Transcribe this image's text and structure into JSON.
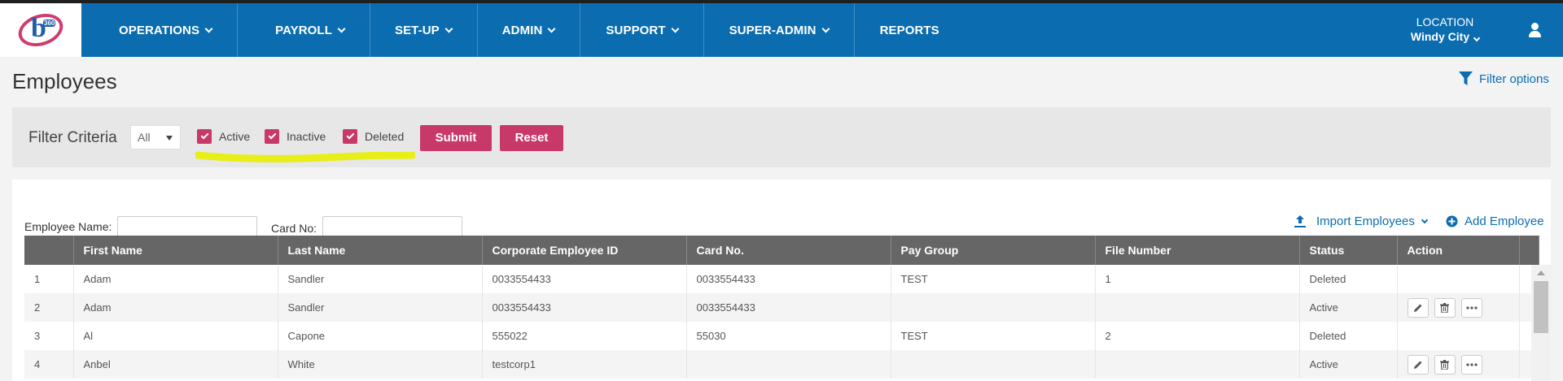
{
  "nav": {
    "logo_badge": "360",
    "menu": [
      {
        "label": "OPERATIONS",
        "has_dropdown": true
      },
      {
        "label": "PAYROLL",
        "has_dropdown": true
      },
      {
        "label": "SET-UP",
        "has_dropdown": true
      },
      {
        "label": "ADMIN",
        "has_dropdown": true
      },
      {
        "label": "SUPPORT",
        "has_dropdown": true
      },
      {
        "label": "SUPER-ADMIN",
        "has_dropdown": true
      },
      {
        "label": "REPORTS",
        "has_dropdown": false
      }
    ],
    "location_label": "LOCATION",
    "location_value": "Windy City",
    "colors": {
      "bar": "#0b6db0",
      "accent": "#c83868"
    }
  },
  "page": {
    "title": "Employees",
    "filter_options_label": "Filter options"
  },
  "filter": {
    "label": "Filter Criteria",
    "select_value": "All",
    "checkboxes": [
      {
        "label": "Active",
        "checked": true
      },
      {
        "label": "Inactive",
        "checked": true
      },
      {
        "label": "Deleted",
        "checked": true
      }
    ],
    "submit_label": "Submit",
    "reset_label": "Reset"
  },
  "search": {
    "employee_name_label": "Employee Name:",
    "employee_name_value": "",
    "card_no_label": "Card No:",
    "card_no_value": "",
    "import_label": "Import Employees",
    "add_label": "Add Employee"
  },
  "table": {
    "columns": [
      "",
      "First Name",
      "Last Name",
      "Corporate Employee ID",
      "Card No.",
      "Pay Group",
      "File Number",
      "Status",
      "Action"
    ],
    "rows": [
      {
        "n": "1",
        "first": "Adam",
        "last": "Sandler",
        "corp_id": "0033554433",
        "card": "0033554433",
        "pay_group": "TEST",
        "file": "1",
        "status": "Deleted",
        "actions": false
      },
      {
        "n": "2",
        "first": "Adam",
        "last": "Sandler",
        "corp_id": "0033554433",
        "card": "0033554433",
        "pay_group": "",
        "file": "",
        "status": "Active",
        "actions": true
      },
      {
        "n": "3",
        "first": "Al",
        "last": "Capone",
        "corp_id": "555022",
        "card": "55030",
        "pay_group": "TEST",
        "file": "2",
        "status": "Deleted",
        "actions": false
      },
      {
        "n": "4",
        "first": "Anbel",
        "last": "White",
        "corp_id": "testcorp1",
        "card": "",
        "pay_group": "",
        "file": "",
        "status": "Active",
        "actions": true
      }
    ]
  }
}
